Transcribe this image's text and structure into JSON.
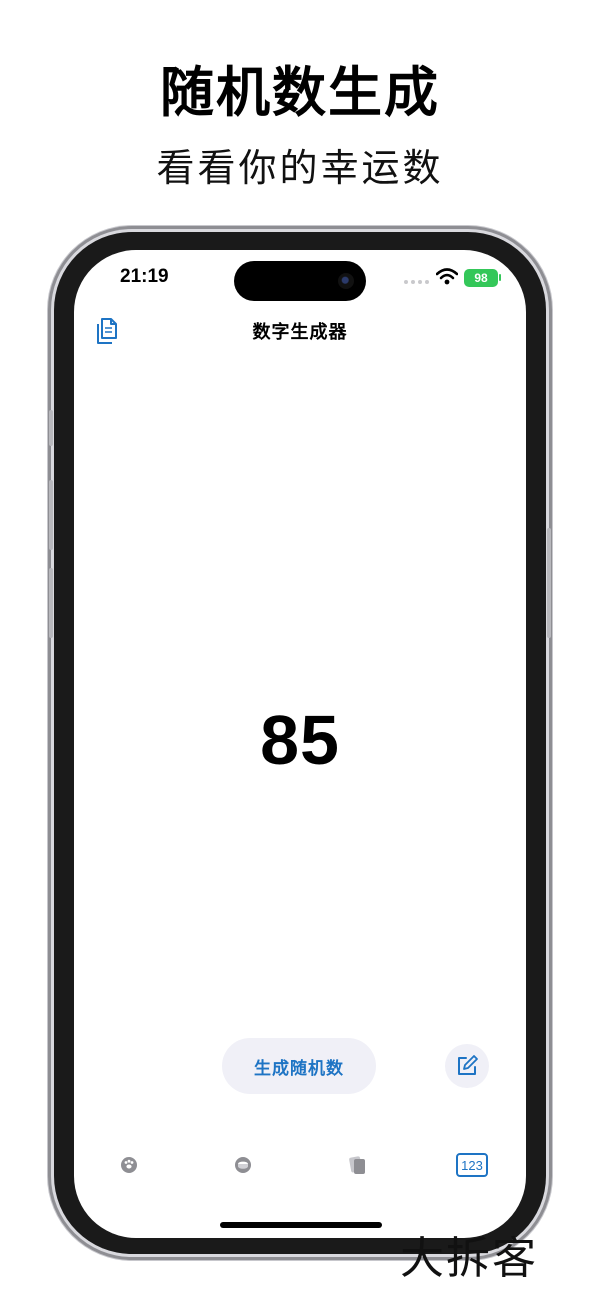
{
  "promo": {
    "title": "随机数生成",
    "subtitle": "看看你的幸运数"
  },
  "status_bar": {
    "time": "21:19",
    "battery": "98"
  },
  "nav": {
    "title": "数字生成器",
    "copy_icon": "copy-documents-icon"
  },
  "main": {
    "number": "85"
  },
  "actions": {
    "generate_label": "生成随机数",
    "edit_icon": "square-pencil-icon"
  },
  "tabs": [
    {
      "icon": "paw-icon"
    },
    {
      "icon": "coin-icon"
    },
    {
      "icon": "cards-icon"
    },
    {
      "icon": "number-123-icon",
      "label": "123",
      "selected": true
    }
  ],
  "watermark": "大拆客",
  "colors": {
    "accent": "#1e74c4",
    "battery": "#34c759",
    "button_bg": "#f0f0f7"
  }
}
